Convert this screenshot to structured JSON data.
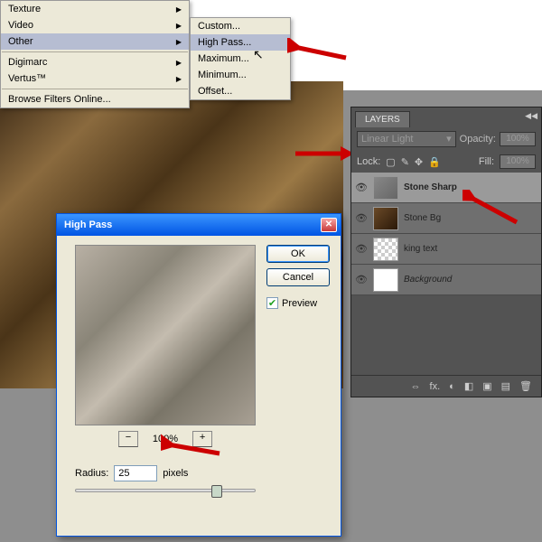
{
  "menu": {
    "items": [
      "Texture",
      "Video",
      "Other",
      "Digimarc",
      "Vertus™",
      "Browse Filters Online..."
    ]
  },
  "submenu": {
    "items": [
      "Custom...",
      "High Pass...",
      "Maximum...",
      "Minimum...",
      "Offset..."
    ]
  },
  "dialog": {
    "title": "High Pass",
    "ok": "OK",
    "cancel": "Cancel",
    "preview": "Preview",
    "zoom_minus": "−",
    "zoom_pct": "100%",
    "zoom_plus": "+",
    "radius_label": "Radius:",
    "radius_value": "25",
    "radius_unit": "pixels"
  },
  "layers": {
    "tab": "LAYERS",
    "blend": "Linear Light",
    "opacity_label": "Opacity:",
    "opacity_val": "100%",
    "lock_label": "Lock:",
    "fill_label": "Fill:",
    "fill_val": "100%",
    "rows": [
      {
        "name": "Stone Sharp",
        "bold": true
      },
      {
        "name": "Stone Bg"
      },
      {
        "name": "king text"
      },
      {
        "name": "Background",
        "italic": true
      }
    ],
    "footer_icons": [
      "⇔",
      "fx.",
      "◐",
      "◧",
      "▣",
      "▤",
      "🗑"
    ]
  }
}
